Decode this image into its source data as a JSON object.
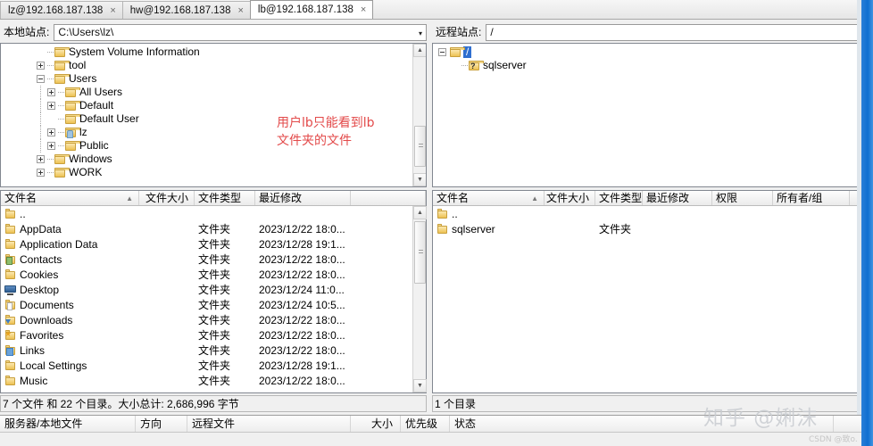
{
  "tabs": [
    {
      "label": "lz@192.168.187.138",
      "active": false,
      "close": "×"
    },
    {
      "label": "hw@192.168.187.138",
      "active": false,
      "close": "×"
    },
    {
      "label": "lb@192.168.187.138",
      "active": true,
      "close": "×"
    }
  ],
  "tabs_menu_icon": "▾",
  "local": {
    "path_label": "本地站点:",
    "path_value": "C:\\Users\\lz\\",
    "dropdown_icon": "▾",
    "tree": [
      {
        "label": "System Volume Information",
        "indent": 1,
        "expander": "none",
        "icon": "folder"
      },
      {
        "label": "tool",
        "indent": 1,
        "expander": "plus",
        "icon": "folder"
      },
      {
        "label": "Users",
        "indent": 1,
        "expander": "minus",
        "icon": "folder"
      },
      {
        "label": "All Users",
        "indent": 2,
        "expander": "plus",
        "icon": "folder"
      },
      {
        "label": "Default",
        "indent": 2,
        "expander": "plus",
        "icon": "folder"
      },
      {
        "label": "Default User",
        "indent": 2,
        "expander": "none",
        "icon": "folder"
      },
      {
        "label": "lz",
        "indent": 2,
        "expander": "plus",
        "icon": "user-folder"
      },
      {
        "label": "Public",
        "indent": 2,
        "expander": "plus",
        "icon": "folder"
      },
      {
        "label": "Windows",
        "indent": 1,
        "expander": "plus",
        "icon": "folder"
      },
      {
        "label": "WORK",
        "indent": 1,
        "expander": "plus",
        "icon": "folder"
      }
    ],
    "columns": [
      "文件名",
      "文件大小",
      "文件类型",
      "最近修改"
    ],
    "rows": [
      {
        "name": "..",
        "size": "",
        "type": "",
        "modified": "",
        "icon": "folder"
      },
      {
        "name": "AppData",
        "size": "",
        "type": "文件夹",
        "modified": "2023/12/22 18:0...",
        "icon": "folder"
      },
      {
        "name": "Application Data",
        "size": "",
        "type": "文件夹",
        "modified": "2023/12/28 19:1...",
        "icon": "folder"
      },
      {
        "name": "Contacts",
        "size": "",
        "type": "文件夹",
        "modified": "2023/12/22 18:0...",
        "icon": "contacts"
      },
      {
        "name": "Cookies",
        "size": "",
        "type": "文件夹",
        "modified": "2023/12/22 18:0...",
        "icon": "folder"
      },
      {
        "name": "Desktop",
        "size": "",
        "type": "文件夹",
        "modified": "2023/12/24 11:0...",
        "icon": "desktop"
      },
      {
        "name": "Documents",
        "size": "",
        "type": "文件夹",
        "modified": "2023/12/24 10:5...",
        "icon": "documents"
      },
      {
        "name": "Downloads",
        "size": "",
        "type": "文件夹",
        "modified": "2023/12/22 18:0...",
        "icon": "downloads"
      },
      {
        "name": "Favorites",
        "size": "",
        "type": "文件夹",
        "modified": "2023/12/22 18:0...",
        "icon": "favorites"
      },
      {
        "name": "Links",
        "size": "",
        "type": "文件夹",
        "modified": "2023/12/22 18:0...",
        "icon": "links"
      },
      {
        "name": "Local Settings",
        "size": "",
        "type": "文件夹",
        "modified": "2023/12/28 19:1...",
        "icon": "folder"
      },
      {
        "name": "Music",
        "size": "",
        "type": "文件夹",
        "modified": "2023/12/22 18:0...",
        "icon": "folder"
      }
    ],
    "status": "7 个文件 和 22 个目录。大小总计: 2,686,996 字节"
  },
  "remote": {
    "path_label": "远程站点:",
    "path_value": "/",
    "dropdown_icon": "▾",
    "tree": [
      {
        "label": "/",
        "indent": 0,
        "expander": "minus",
        "icon": "folder",
        "selected": true
      },
      {
        "label": "sqlserver",
        "indent": 1,
        "expander": "none",
        "icon": "unknown-folder",
        "selected": false
      }
    ],
    "columns": [
      "文件名",
      "文件大小",
      "文件类型",
      "最近修改",
      "权限",
      "所有者/组"
    ],
    "rows": [
      {
        "name": "..",
        "size": "",
        "type": "",
        "modified": "",
        "perm": "",
        "owner": "",
        "icon": "folder"
      },
      {
        "name": "sqlserver",
        "size": "",
        "type": "文件夹",
        "modified": "",
        "perm": "",
        "owner": "",
        "icon": "folder"
      }
    ],
    "status": "1 个目录"
  },
  "annotation": {
    "line1": "用户lb只能看到lb",
    "line2": "文件夹的文件",
    "color": "#e34a4a"
  },
  "queue": {
    "columns": [
      "服务器/本地文件",
      "方向",
      "远程文件",
      "大小",
      "优先级",
      "状态"
    ]
  },
  "watermarks": {
    "zhihu": "知乎 @娳沫",
    "csdn": "CSDN @致o."
  },
  "scroll": {
    "up_arrow": "▲",
    "down_arrow": "▼"
  }
}
